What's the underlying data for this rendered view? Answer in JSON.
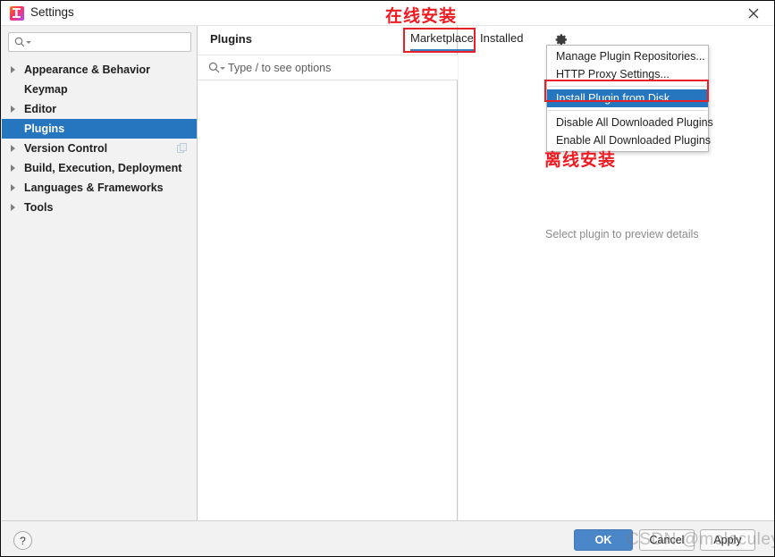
{
  "window": {
    "title": "Settings",
    "logo_icon": "intellij-idea-logo",
    "close_icon": "close-icon"
  },
  "sidebar": {
    "search": {
      "value": "",
      "placeholder": "",
      "icon": "search-icon"
    },
    "items": [
      {
        "label": "Appearance & Behavior",
        "expandable": true,
        "selected": false,
        "extra_icon": ""
      },
      {
        "label": "Keymap",
        "expandable": false,
        "selected": false,
        "extra_icon": ""
      },
      {
        "label": "Editor",
        "expandable": true,
        "selected": false,
        "extra_icon": ""
      },
      {
        "label": "Plugins",
        "expandable": false,
        "selected": true,
        "extra_icon": ""
      },
      {
        "label": "Version Control",
        "expandable": true,
        "selected": false,
        "extra_icon": "copy-icon"
      },
      {
        "label": "Build, Execution, Deployment",
        "expandable": true,
        "selected": false,
        "extra_icon": ""
      },
      {
        "label": "Languages & Frameworks",
        "expandable": true,
        "selected": false,
        "extra_icon": ""
      },
      {
        "label": "Tools",
        "expandable": true,
        "selected": false,
        "extra_icon": ""
      }
    ]
  },
  "plugins": {
    "heading": "Plugins",
    "search": {
      "value": "",
      "placeholder": "Type / to see options",
      "icon": "search-icon"
    },
    "loading_icon": "loading-spinner"
  },
  "right_panel": {
    "tabs": [
      {
        "label": "Marketplace",
        "active": true
      },
      {
        "label": "Installed",
        "active": false
      }
    ],
    "gear_icon": "gear-icon",
    "preview_placeholder": "Select plugin to preview details"
  },
  "plugin_menu": {
    "items": [
      {
        "label": "Manage Plugin Repositories...",
        "highlighted": false,
        "separator_after": false
      },
      {
        "label": "HTTP Proxy Settings...",
        "highlighted": false,
        "separator_after": true
      },
      {
        "label": "Install Plugin from Disk...",
        "highlighted": true,
        "separator_after": true
      },
      {
        "label": "Disable All Downloaded Plugins",
        "highlighted": false,
        "separator_after": false
      },
      {
        "label": "Enable All Downloaded Plugins",
        "highlighted": false,
        "separator_after": false
      }
    ]
  },
  "annotations": {
    "online_install": "在线安装",
    "offline_install": "离线安装",
    "color": "#ee1c22"
  },
  "footer": {
    "help_label": "?",
    "ok_label": "OK",
    "cancel_label": "Cancel",
    "apply_label": "Apply"
  },
  "watermark": {
    "text": "CSDN @moleculeyjp"
  },
  "colors": {
    "selection_blue": "#2675bf",
    "tab_underline": "#3e7fc1",
    "ok_button": "#4a86c8",
    "annotation_red": "#ee1c22"
  }
}
